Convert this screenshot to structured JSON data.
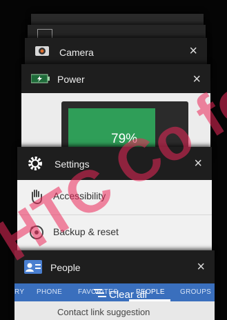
{
  "cards": {
    "back": {
      "title": ""
    },
    "camera": {
      "title": "Camera",
      "close": "×"
    },
    "power": {
      "title": "Power",
      "battery_percent": "79%",
      "close": "×"
    },
    "settings": {
      "title": "Settings",
      "close": "×",
      "items": [
        {
          "label": "Accessibility",
          "icon": "hand-icon"
        },
        {
          "label": "Backup & reset",
          "icon": "backup-icon"
        }
      ]
    },
    "people": {
      "title": "People",
      "close": "×",
      "tabs": [
        "RY",
        "PHONE",
        "FAVORITES",
        "PEOPLE",
        "GROUPS"
      ],
      "active_tab": "PEOPLE",
      "suggestion": "Contact link suggestion"
    }
  },
  "clear_all": {
    "label": "Clear all"
  },
  "watermark": {
    "text": "HTC Co for Co",
    "color": "#eb285a"
  },
  "colors": {
    "battery": "#2f9e58",
    "tab_bar": "#3a6fbd"
  }
}
